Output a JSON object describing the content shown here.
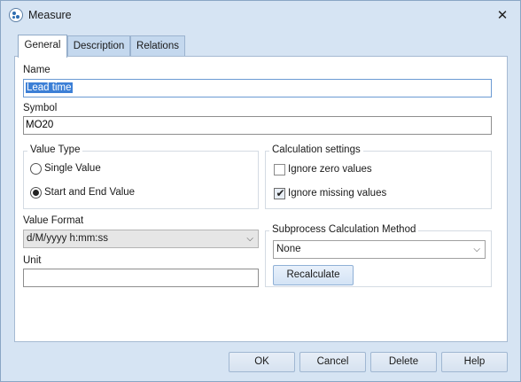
{
  "window": {
    "title": "Measure",
    "close_glyph": "✕"
  },
  "tabs": [
    {
      "label": "General",
      "active": true
    },
    {
      "label": "Description",
      "active": false
    },
    {
      "label": "Relations",
      "active": false
    }
  ],
  "general": {
    "name_label": "Name",
    "name_value": "Lead time",
    "symbol_label": "Symbol",
    "symbol_value": "MO20",
    "value_type": {
      "title": "Value Type",
      "options": [
        {
          "label": "Single Value",
          "selected": false
        },
        {
          "label": "Start and End Value",
          "selected": true
        }
      ]
    },
    "calculation_settings": {
      "title": "Calculation settings",
      "options": [
        {
          "label": "Ignore zero values",
          "checked": false
        },
        {
          "label": "Ignore missing values",
          "checked": true
        }
      ]
    },
    "value_format_label": "Value Format",
    "value_format_value": "d/M/yyyy h:mm:ss",
    "unit_label": "Unit",
    "unit_value": "",
    "subprocess": {
      "title": "Subprocess Calculation Method",
      "method_value": "None",
      "recalculate_label": "Recalculate"
    }
  },
  "footer": {
    "ok_label": "OK",
    "cancel_label": "Cancel",
    "delete_label": "Delete",
    "help_label": "Help"
  },
  "icons": {
    "app": "measure-app-icon",
    "close": "close-icon",
    "dropdown": "chevron-down-icon",
    "checkmark": "checkmark-icon"
  }
}
